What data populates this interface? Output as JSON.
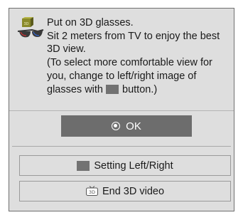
{
  "dialog": {
    "message_lines": [
      "Put on 3D glasses.",
      "Sit 2 meters from TV to enjoy the best",
      "3D view.",
      "(To select more comfortable view for",
      "you, change to left/right image of"
    ],
    "message_last_before": "glasses with",
    "message_last_after": "button.)",
    "icon": "3d-glasses-icon",
    "ok_label": "OK",
    "setting_label": "Setting Left/Right",
    "end_label": "End 3D video",
    "colors": {
      "background": "#dedede",
      "button": "#6d6d6d",
      "swatch": "#727272"
    }
  }
}
